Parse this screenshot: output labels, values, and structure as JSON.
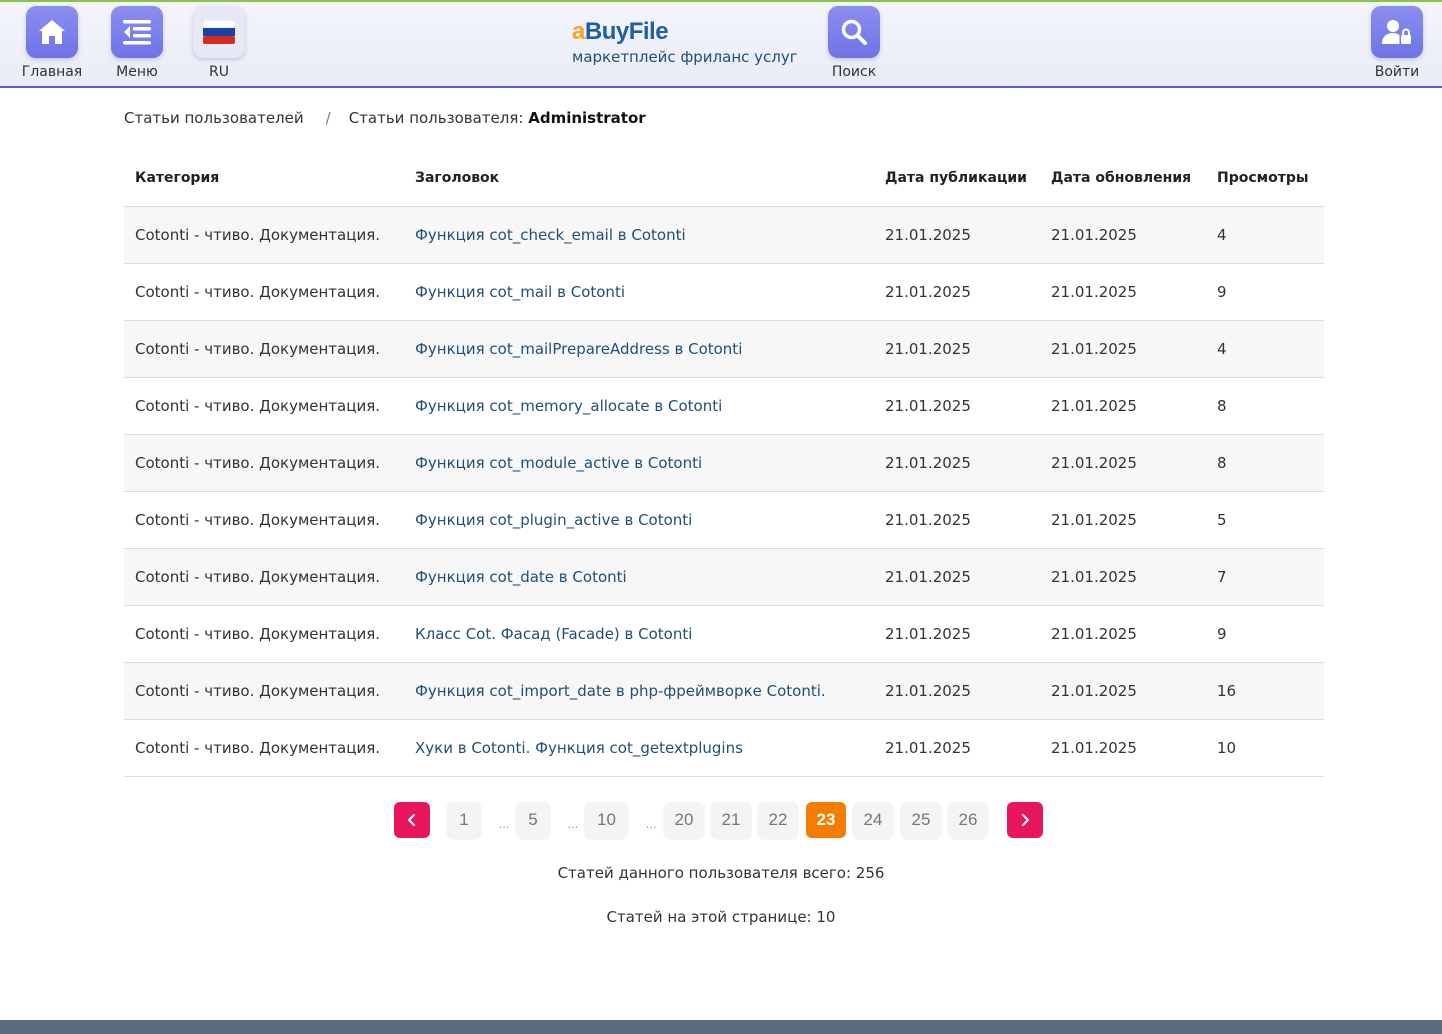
{
  "nav": {
    "home_label": "Главная",
    "menu_label": "Меню",
    "lang_label": "RU",
    "search_label": "Поиск",
    "login_label": "Войти"
  },
  "brand": {
    "logo_prefix": "a",
    "logo_main": "BuyFile",
    "tagline": "маркетплейс фриланс услуг"
  },
  "breadcrumb": {
    "root": "Статьи пользователей",
    "separator": "/",
    "current_prefix": "Статьи пользователя:",
    "current_user": "Administrator"
  },
  "table": {
    "headers": {
      "category": "Категория",
      "title": "Заголовок",
      "published": "Дата публикации",
      "updated": "Дата обновления",
      "views": "Просмотры"
    },
    "rows": [
      {
        "category": "Cotonti - чтиво. Документация.",
        "title": "Функция cot_check_email в Cotonti",
        "published": "21.01.2025",
        "updated": "21.01.2025",
        "views": "4"
      },
      {
        "category": "Cotonti - чтиво. Документация.",
        "title": "Функция cot_mail в Cotonti",
        "published": "21.01.2025",
        "updated": "21.01.2025",
        "views": "9"
      },
      {
        "category": "Cotonti - чтиво. Документация.",
        "title": "Функция cot_mailPrepareAddress в Cotonti",
        "published": "21.01.2025",
        "updated": "21.01.2025",
        "views": "4"
      },
      {
        "category": "Cotonti - чтиво. Документация.",
        "title": "Функция cot_memory_allocate в Cotonti",
        "published": "21.01.2025",
        "updated": "21.01.2025",
        "views": "8"
      },
      {
        "category": "Cotonti - чтиво. Документация.",
        "title": "Функция cot_module_active в Cotonti",
        "published": "21.01.2025",
        "updated": "21.01.2025",
        "views": "8"
      },
      {
        "category": "Cotonti - чтиво. Документация.",
        "title": "Функция cot_plugin_active в Cotonti",
        "published": "21.01.2025",
        "updated": "21.01.2025",
        "views": "5"
      },
      {
        "category": "Cotonti - чтиво. Документация.",
        "title": "Функция cot_date в Cotonti",
        "published": "21.01.2025",
        "updated": "21.01.2025",
        "views": "7"
      },
      {
        "category": "Cotonti - чтиво. Документация.",
        "title": "Класс Cot. Фасад (Facade) в Cotonti",
        "published": "21.01.2025",
        "updated": "21.01.2025",
        "views": "9"
      },
      {
        "category": "Cotonti - чтиво. Документация.",
        "title": "Функция cot_import_date в php-фреймворке Cotonti.",
        "published": "21.01.2025",
        "updated": "21.01.2025",
        "views": "16"
      },
      {
        "category": "Cotonti - чтиво. Документация.",
        "title": "Хуки в Cotonti. Функция cot_getextplugins",
        "published": "21.01.2025",
        "updated": "21.01.2025",
        "views": "10"
      }
    ]
  },
  "pagination": {
    "prev": "‹",
    "next": "›",
    "dots": "...",
    "pages": [
      "1",
      "5",
      "10",
      "20",
      "21",
      "22",
      "23",
      "24",
      "25",
      "26"
    ],
    "current": "23"
  },
  "stats": {
    "total": "Статей данного пользователя всего: 256",
    "on_page": "Статей на этой странице: 10"
  },
  "colors": {
    "nav_tile": "#7a7eea",
    "accent_top": "#8bc34a",
    "active_page": "#f57c00",
    "arrow_button": "#e8175d",
    "link": "#1f4e79"
  }
}
